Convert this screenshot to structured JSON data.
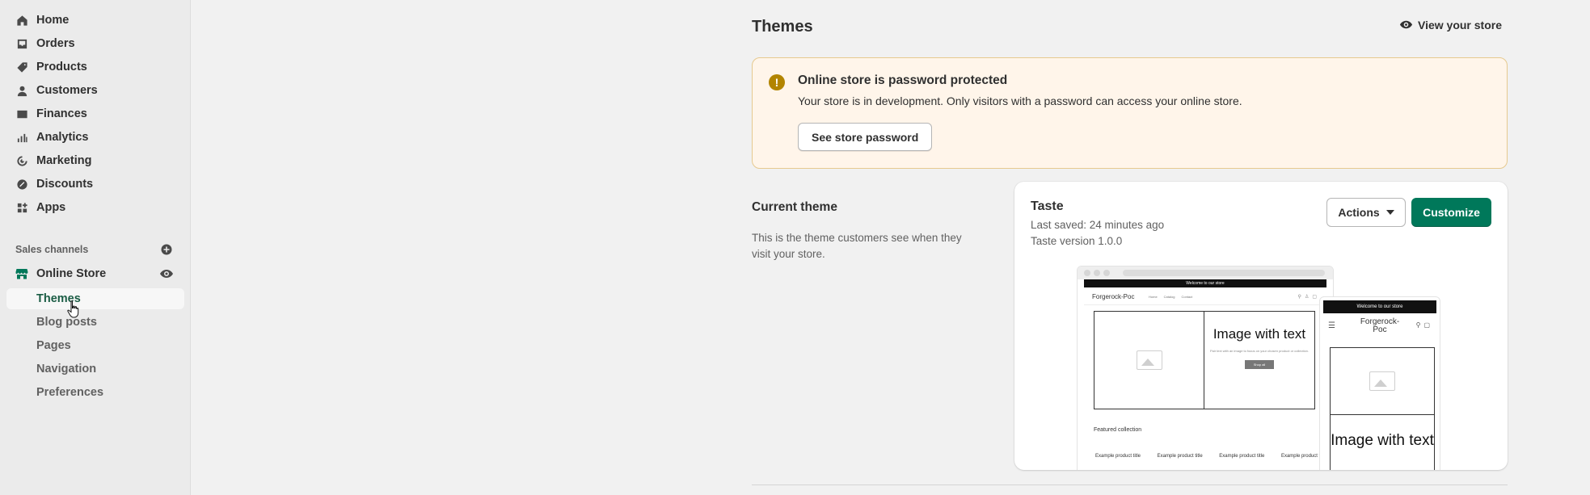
{
  "sidebar": {
    "items": [
      {
        "label": "Home",
        "icon": "home-icon"
      },
      {
        "label": "Orders",
        "icon": "orders-icon"
      },
      {
        "label": "Products",
        "icon": "tag-icon"
      },
      {
        "label": "Customers",
        "icon": "person-icon"
      },
      {
        "label": "Finances",
        "icon": "bank-icon"
      },
      {
        "label": "Analytics",
        "icon": "bar-chart-icon"
      },
      {
        "label": "Marketing",
        "icon": "target-icon"
      },
      {
        "label": "Discounts",
        "icon": "discount-icon"
      },
      {
        "label": "Apps",
        "icon": "apps-icon"
      }
    ],
    "sales_channels_label": "Sales channels",
    "online_store_label": "Online Store",
    "sub_items": [
      {
        "label": "Themes",
        "active": true
      },
      {
        "label": "Blog posts",
        "active": false
      },
      {
        "label": "Pages",
        "active": false
      },
      {
        "label": "Navigation",
        "active": false
      },
      {
        "label": "Preferences",
        "active": false
      }
    ]
  },
  "main": {
    "title": "Themes",
    "view_store_label": "View your store",
    "banner": {
      "title": "Online store is password protected",
      "text": "Your store is in development. Only visitors with a password can access your online store.",
      "button_label": "See store password"
    },
    "current_theme": {
      "heading": "Current theme",
      "description": "This is the theme customers see when they visit your store.",
      "name": "Taste",
      "last_saved": "Last saved: 24 minutes ago",
      "version": "Taste version 1.0.0",
      "actions_label": "Actions",
      "customize_label": "Customize"
    },
    "preview": {
      "announcement": "Welcome to our store",
      "store_name": "Forgerock-Poc",
      "nav_links": [
        "Home",
        "Catalog",
        "Contact"
      ],
      "hero_title": "Image with text",
      "hero_body": "Pair text with an image to focus on your chosen product or collection.",
      "hero_button": "Shop all",
      "featured_heading": "Featured collection",
      "product_title": "Example product title"
    }
  },
  "colors": {
    "primary": "#00785a",
    "active_text": "#1a5c44",
    "banner_bg": "#fff5ea",
    "banner_border": "#e6c98f",
    "warning_icon": "#b28400"
  }
}
